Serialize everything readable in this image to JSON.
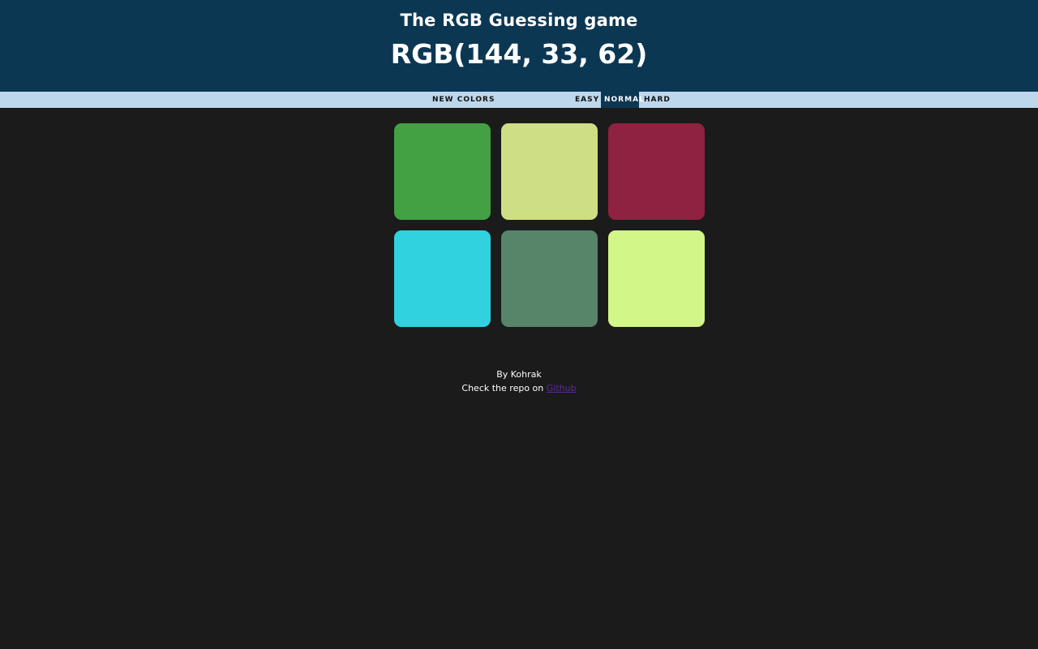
{
  "header": {
    "title": "The RGB Guessing game",
    "rgb_display": "RGB(144, 33, 62)"
  },
  "toolbar": {
    "new_colors_label": "NEW COLORS",
    "modes": [
      {
        "label": "EASY",
        "selected": false
      },
      {
        "label": "NORMAL",
        "selected": true
      },
      {
        "label": "HARD",
        "selected": false
      }
    ]
  },
  "squares": [
    {
      "color": "#43a043"
    },
    {
      "color": "#cede84"
    },
    {
      "color": "#8f2240"
    },
    {
      "color": "#30d2e0"
    },
    {
      "color": "#56856a"
    },
    {
      "color": "#d2f687"
    }
  ],
  "footer": {
    "author_line": "By Kohrak",
    "repo_prefix": "Check the repo on ",
    "repo_link_text": "Github"
  },
  "colors": {
    "header_bg": "#0b3753",
    "toolbar_bg": "#bdd7ec",
    "page_bg": "#1b1b1b",
    "link": "#5b2a9a"
  }
}
